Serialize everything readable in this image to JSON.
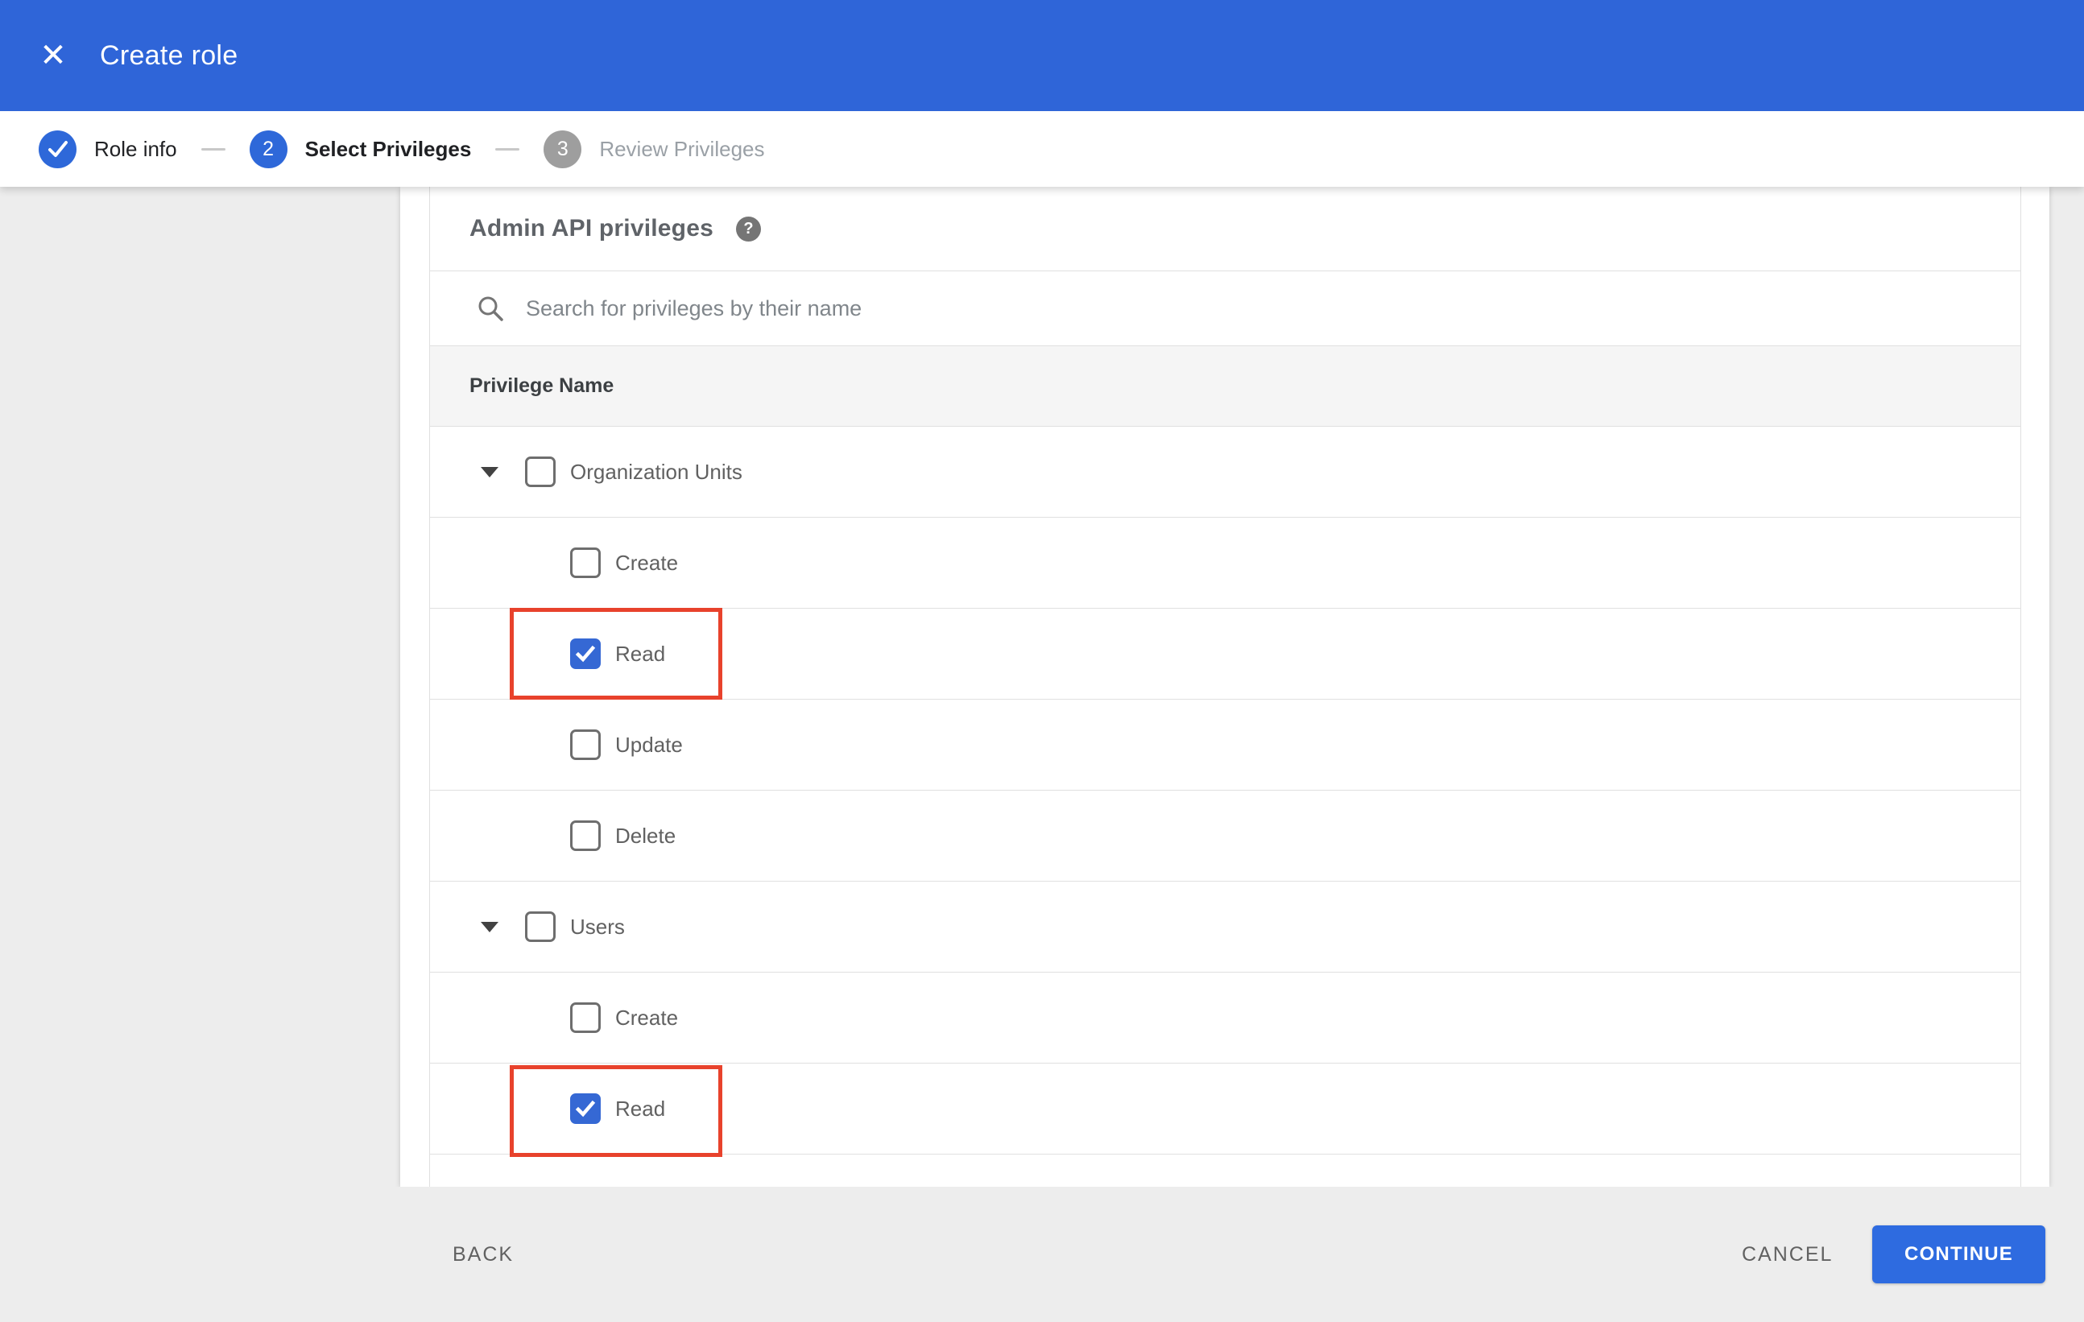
{
  "header": {
    "title": "Create role",
    "close_icon": "✕"
  },
  "stepper": {
    "steps": [
      {
        "num": "1",
        "label": "Role info",
        "state": "completed",
        "icon": "check-icon"
      },
      {
        "num": "2",
        "label": "Select Privileges",
        "state": "active"
      },
      {
        "num": "3",
        "label": "Review Privileges",
        "state": "upcoming"
      }
    ]
  },
  "content": {
    "section_title": "Admin API privileges",
    "help_icon": "?",
    "search": {
      "icon": "search-icon",
      "placeholder": "Search for privileges by their name",
      "value": ""
    },
    "table": {
      "header": "Privilege Name",
      "rows": [
        {
          "type": "group",
          "label": "Organization Units",
          "checked": false,
          "expanded": true,
          "highlighted": false
        },
        {
          "type": "child",
          "label": "Create",
          "checked": false,
          "highlighted": false
        },
        {
          "type": "child",
          "label": "Read",
          "checked": true,
          "highlighted": true
        },
        {
          "type": "child",
          "label": "Update",
          "checked": false,
          "highlighted": false
        },
        {
          "type": "child",
          "label": "Delete",
          "checked": false,
          "highlighted": false
        },
        {
          "type": "group",
          "label": "Users",
          "checked": false,
          "expanded": true,
          "highlighted": false
        },
        {
          "type": "child",
          "label": "Create",
          "checked": false,
          "highlighted": false
        },
        {
          "type": "child",
          "label": "Read",
          "checked": true,
          "highlighted": true
        }
      ]
    }
  },
  "footer": {
    "back_label": "BACK",
    "cancel_label": "CANCEL",
    "continue_label": "CONTINUE"
  },
  "colors": {
    "appbar_blue": "#2f65d8",
    "step_blue": "#2e68d9",
    "checkbox_blue": "#3568d4",
    "button_blue": "#2e6be0",
    "highlight_red": "#e8422c",
    "background_gray": "#ededed",
    "table_header_gray": "#f5f5f5",
    "border_gray": "#e0e0e0"
  }
}
